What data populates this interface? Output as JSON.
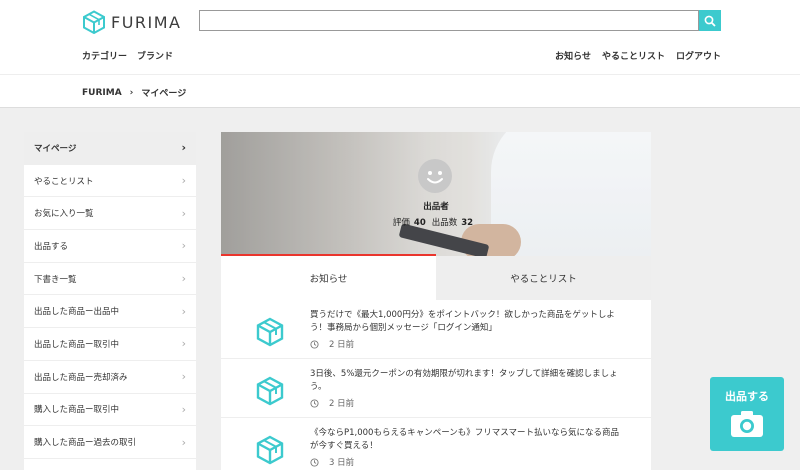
{
  "header": {
    "logo_text": "FURIMA",
    "search": {
      "value": "",
      "placeholder": ""
    },
    "nav_left": [
      "カテゴリー",
      "ブランド"
    ],
    "nav_right": [
      "お知らせ",
      "やることリスト",
      "ログアウト"
    ]
  },
  "breadcrumb": {
    "home": "FURIMA",
    "current": "マイページ"
  },
  "sidebar": {
    "items": [
      {
        "label": "マイページ",
        "active": true
      },
      {
        "label": "やることリスト"
      },
      {
        "label": "お気に入り一覧"
      },
      {
        "label": "出品する"
      },
      {
        "label": "下書き一覧"
      },
      {
        "label": "出品した商品ー出品中"
      },
      {
        "label": "出品した商品ー取引中"
      },
      {
        "label": "出品した商品ー売却済み"
      },
      {
        "label": "購入した商品ー取引中"
      },
      {
        "label": "購入した商品ー過去の取引"
      }
    ]
  },
  "profile": {
    "name": "出品者",
    "rating_label": "評価",
    "rating_value": "40",
    "listings_label": "出品数",
    "listings_value": "32"
  },
  "tabs": [
    {
      "label": "お知らせ",
      "active": true
    },
    {
      "label": "やることリスト",
      "active": false
    }
  ],
  "news": [
    {
      "text": "買うだけで《最大1,000円分》をポイントバック！欲しかった商品をゲットしよう！事務局から個別メッセージ「ログイン通知」",
      "time": "2 日前"
    },
    {
      "text": "3日後、5%還元クーポンの有効期限が切れます！タップして詳細を確認しましょう。",
      "time": "2 日前"
    },
    {
      "text": "《今ならP1,000もらえるキャンペーンも》フリマスマート払いなら気になる商品が今すぐ買える！",
      "time": "3 日前"
    }
  ],
  "sell_button": {
    "label": "出品する"
  },
  "colors": {
    "accent": "#3ccace",
    "tab_underline": "#ea352d"
  }
}
